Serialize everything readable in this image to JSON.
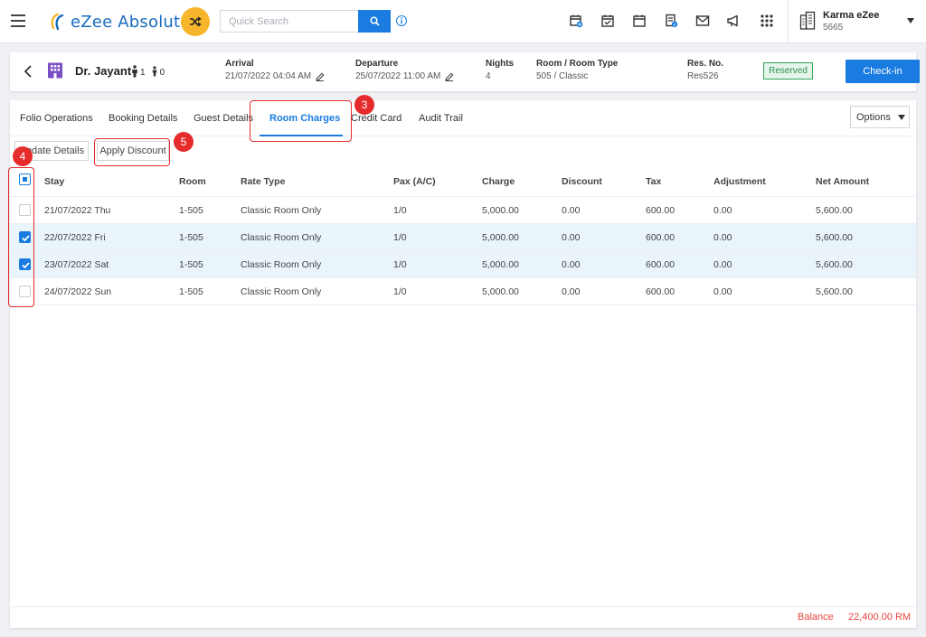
{
  "app": {
    "name": "eZee Absolute"
  },
  "search": {
    "placeholder": "Quick Search"
  },
  "property": {
    "name": "Karma eZee",
    "code": "5665"
  },
  "reservation": {
    "guest_name": "Dr. Jayant",
    "adults": "1",
    "children": "0",
    "arrival_label": "Arrival",
    "arrival_value": "21/07/2022 04:04 AM",
    "departure_label": "Departure",
    "departure_value": "25/07/2022 11:00 AM",
    "nights_label": "Nights",
    "nights_value": "4",
    "room_label": "Room / Room Type",
    "room_value": "505 / Classic",
    "resno_label": "Res. No.",
    "resno_value": "Res526",
    "status": "Reserved",
    "checkin_label": "Check-in"
  },
  "tabs": [
    {
      "label": "Folio Operations"
    },
    {
      "label": "Booking Details"
    },
    {
      "label": "Guest Details"
    },
    {
      "label": "Room Charges"
    },
    {
      "label": "Credit Card"
    },
    {
      "label": "Audit Trail"
    }
  ],
  "options_label": "Options",
  "actions": {
    "update_details": "Update Details",
    "apply_discount": "Apply Discount"
  },
  "table": {
    "columns": [
      "Stay",
      "Room",
      "Rate Type",
      "Pax (A/C)",
      "Charge",
      "Discount",
      "Tax",
      "Adjustment",
      "Net Amount"
    ],
    "rows": [
      {
        "stay": "21/07/2022 Thu",
        "room": "1-505",
        "rate_type": "Classic Room Only",
        "pax": "1/0",
        "charge": "5,000.00",
        "discount": "0.00",
        "tax": "600.00",
        "adjustment": "0.00",
        "net": "5,600.00"
      },
      {
        "stay": "22/07/2022 Fri",
        "room": "1-505",
        "rate_type": "Classic Room Only",
        "pax": "1/0",
        "charge": "5,000.00",
        "discount": "0.00",
        "tax": "600.00",
        "adjustment": "0.00",
        "net": "5,600.00"
      },
      {
        "stay": "23/07/2022 Sat",
        "room": "1-505",
        "rate_type": "Classic Room Only",
        "pax": "1/0",
        "charge": "5,000.00",
        "discount": "0.00",
        "tax": "600.00",
        "adjustment": "0.00",
        "net": "5,600.00"
      },
      {
        "stay": "24/07/2022 Sun",
        "room": "1-505",
        "rate_type": "Classic Room Only",
        "pax": "1/0",
        "charge": "5,000.00",
        "discount": "0.00",
        "tax": "600.00",
        "adjustment": "0.00",
        "net": "5,600.00"
      }
    ]
  },
  "footer": {
    "balance_label": "Balance",
    "balance_value": "22,400.00 RM"
  },
  "annotations": {
    "tab_step": "3",
    "checkbox_step": "4",
    "discount_step": "5"
  },
  "colors": {
    "primary": "#1a7ce0",
    "accent": "#f7b52c",
    "status_green": "#2fa35a",
    "balance_red": "#e9443c",
    "annotation_red": "#e52b2b",
    "selected_row": "#e9f4fb"
  }
}
